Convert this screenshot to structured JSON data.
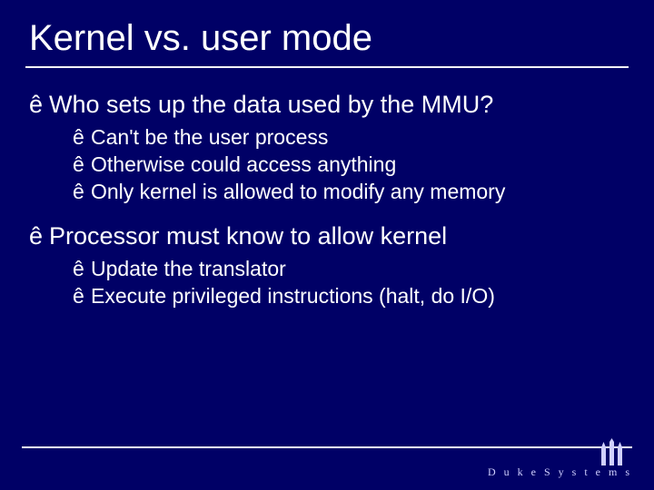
{
  "slide": {
    "title": "Kernel vs. user mode",
    "bullet_char": "ê",
    "points": [
      {
        "text": "Who sets up the data used by the MMU?",
        "sub": [
          "Can't be the user process",
          "Otherwise could access anything",
          "Only kernel is allowed to modify any memory"
        ]
      },
      {
        "text": "Processor must know to allow kernel",
        "sub": [
          "Update the translator",
          "Execute privileged instructions (halt, do I/O)"
        ]
      }
    ]
  },
  "footer": {
    "brand": "D u k e  S y s t e m s"
  }
}
